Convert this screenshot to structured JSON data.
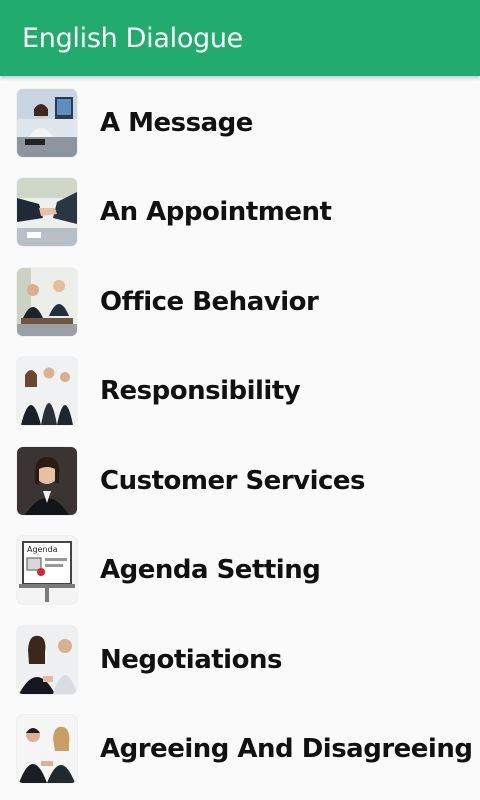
{
  "app_bar": {
    "title": "English Dialogue",
    "color": "#22ab6f"
  },
  "list": {
    "items": [
      {
        "label": "A Message",
        "icon": "phone-call-office-photo-icon"
      },
      {
        "label": "An Appointment",
        "icon": "handshake-photo-icon"
      },
      {
        "label": "Office Behavior",
        "icon": "office-meeting-photo-icon"
      },
      {
        "label": "Responsibility",
        "icon": "business-team-photo-icon"
      },
      {
        "label": "Customer Services",
        "icon": "customer-service-agent-photo-icon"
      },
      {
        "label": "Agenda Setting",
        "icon": "agenda-board-photo-icon"
      },
      {
        "label": "Negotiations",
        "icon": "negotiation-photo-icon"
      },
      {
        "label": "Agreeing And Disagreeing",
        "icon": "agree-disagree-photo-icon"
      }
    ]
  }
}
